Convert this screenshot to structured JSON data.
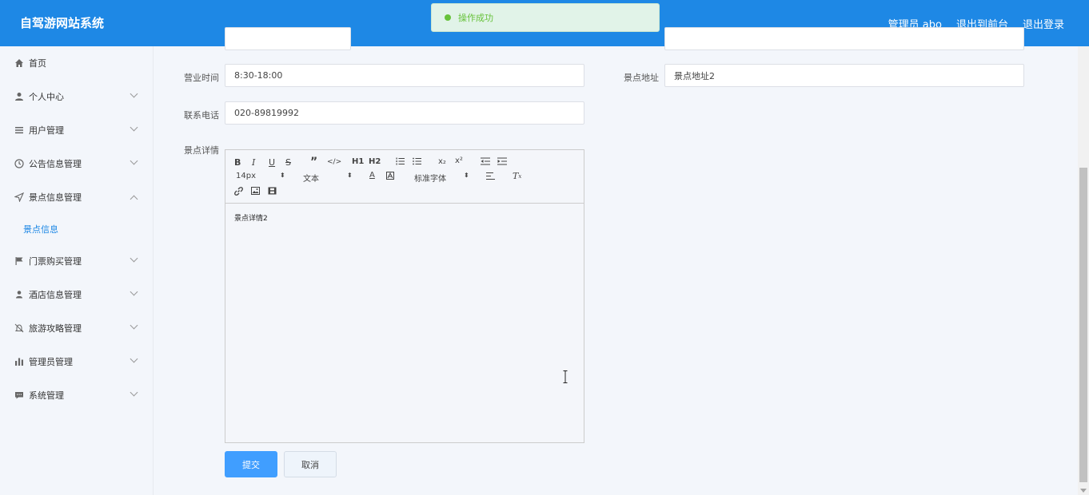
{
  "header": {
    "title": "自驾游网站系统",
    "user": "管理员 abo",
    "to_front": "退出到前台",
    "logout": "退出登录"
  },
  "toast": {
    "message": "操作成功"
  },
  "sidebar": {
    "items": [
      {
        "label": "首页",
        "icon": "home-icon"
      },
      {
        "label": "个人中心",
        "icon": "user-icon"
      },
      {
        "label": "用户管理",
        "icon": "list-icon"
      },
      {
        "label": "公告信息管理",
        "icon": "clock-icon"
      },
      {
        "label": "景点信息管理",
        "icon": "navigation-icon"
      },
      {
        "label": "门票购买管理",
        "icon": "flag-icon"
      },
      {
        "label": "酒店信息管理",
        "icon": "person-icon"
      },
      {
        "label": "旅游攻略管理",
        "icon": "bell-off-icon"
      },
      {
        "label": "管理员管理",
        "icon": "bar-chart-icon"
      },
      {
        "label": "系统管理",
        "icon": "chat-icon"
      }
    ],
    "sub_item": "景点信息"
  },
  "form": {
    "hours_label": "营业时间",
    "hours_value": "8:30-18:00",
    "address_label": "景点地址",
    "address_value": "景点地址2",
    "phone_label": "联系电话",
    "phone_value": "020-89819992",
    "detail_label": "景点详情",
    "detail_value": "景点详情2",
    "submit": "提交",
    "cancel": "取消"
  },
  "editor_toolbar": {
    "size": "14px",
    "header": "文本",
    "font": "标准字体",
    "h1": "H1",
    "h2": "H2",
    "sub": "x₂",
    "sup": "x²"
  },
  "colors": {
    "header_bg": "#1e88e5",
    "primary": "#409eff",
    "success": "#67c23a"
  }
}
